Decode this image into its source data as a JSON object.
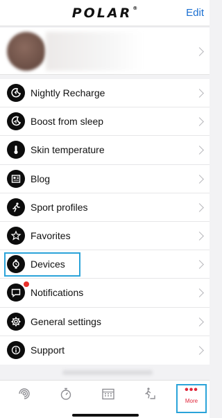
{
  "header": {
    "logo": "POLAR",
    "logo_mark": "®",
    "edit_label": "Edit"
  },
  "menu": {
    "items": [
      {
        "label": "Nightly Recharge",
        "icon": "nightly-recharge-icon"
      },
      {
        "label": "Boost from sleep",
        "icon": "moon-icon"
      },
      {
        "label": "Skin temperature",
        "icon": "thermometer-icon"
      },
      {
        "label": "Blog",
        "icon": "blog-icon"
      },
      {
        "label": "Sport profiles",
        "icon": "runner-icon"
      },
      {
        "label": "Favorites",
        "icon": "star-icon"
      },
      {
        "label": "Devices",
        "icon": "watch-icon"
      },
      {
        "label": "Notifications",
        "icon": "message-icon",
        "badge": true
      },
      {
        "label": "General settings",
        "icon": "gear-icon"
      },
      {
        "label": "Support",
        "icon": "info-icon"
      }
    ]
  },
  "tabbar": {
    "tabs": [
      "activity-icon",
      "stopwatch-icon",
      "calendar-icon",
      "progress-icon"
    ],
    "more_dots": "•••",
    "more_label": "More"
  },
  "colors": {
    "accent_blue": "#1a6fd1",
    "highlight_blue": "#2aa3d9",
    "more_red": "#e0263a",
    "badge_red": "#e8302a"
  }
}
